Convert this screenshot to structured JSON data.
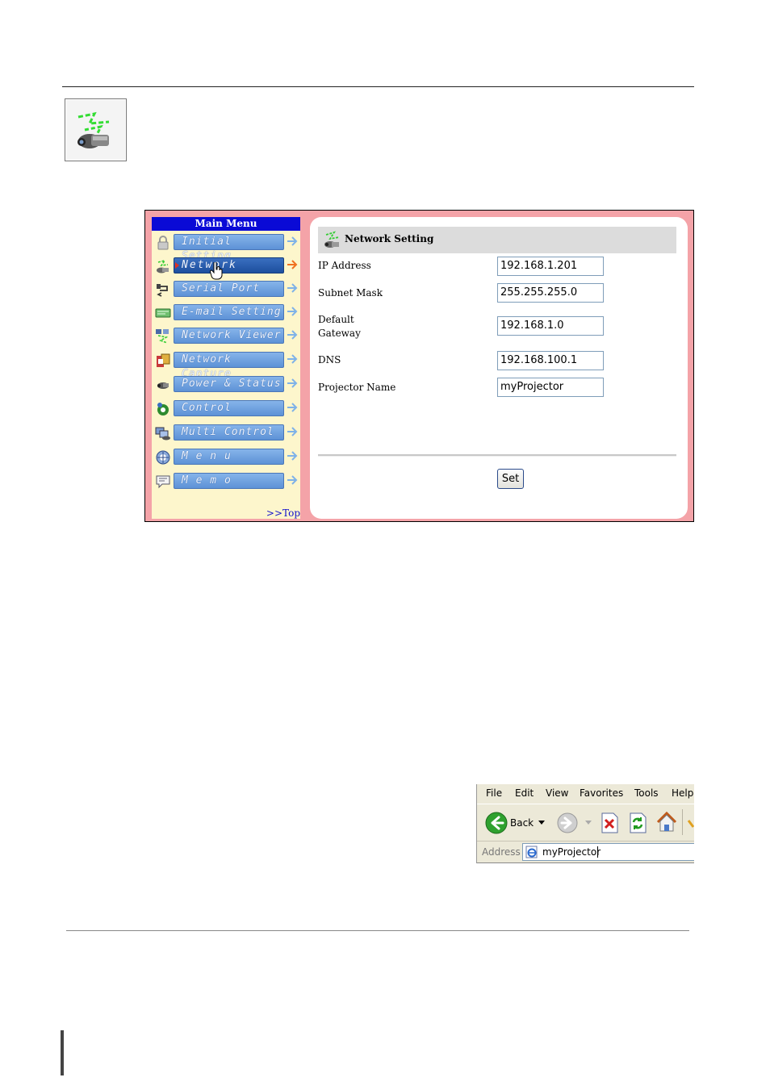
{
  "web_ui": {
    "menu": {
      "header": "Main Menu",
      "items": [
        {
          "label": "Initial Setting",
          "icon": "lock-icon"
        },
        {
          "label": "Network",
          "icon": "network-icon",
          "active": true
        },
        {
          "label": "Serial Port",
          "icon": "serial-port-icon"
        },
        {
          "label": "E-mail Setting",
          "icon": "email-icon"
        },
        {
          "label": "Network Viewer",
          "icon": "network-viewer-icon"
        },
        {
          "label": "Network Capture",
          "icon": "network-capture-icon"
        },
        {
          "label": "Power & Status",
          "icon": "power-status-icon"
        },
        {
          "label": "Control",
          "icon": "control-icon"
        },
        {
          "label": "Multi Control",
          "icon": "multi-control-icon"
        },
        {
          "label": "M e n u",
          "icon": "menu-icon"
        },
        {
          "label": "M e m o",
          "icon": "memo-icon"
        }
      ],
      "top_link": ">>Top"
    },
    "content": {
      "title": "Network Setting",
      "fields": [
        {
          "label": "IP Address",
          "value": "192.168.1.201"
        },
        {
          "label": "Subnet Mask",
          "value": "255.255.255.0"
        },
        {
          "label_line1": "Default",
          "label_line2": "Gateway",
          "value": "192.168.1.0"
        },
        {
          "label": "DNS",
          "value": "192.168.100.1"
        },
        {
          "label": "Projector Name",
          "value": "myProjector"
        }
      ],
      "set_button": "Set"
    }
  },
  "browser": {
    "menubar": [
      "File",
      "Edit",
      "View",
      "Favorites",
      "Tools",
      "Help"
    ],
    "back_label": "Back",
    "address_label": "Address",
    "address_value": "myProjector"
  },
  "colors": {
    "frame_pink": "#f4a3a8",
    "menu_bg": "#fdf6cc",
    "menu_header": "#0a0ad6",
    "menu_button": "#6a9ddd",
    "arrow": "#7fb2e8",
    "active_arrow": "#f07020"
  }
}
